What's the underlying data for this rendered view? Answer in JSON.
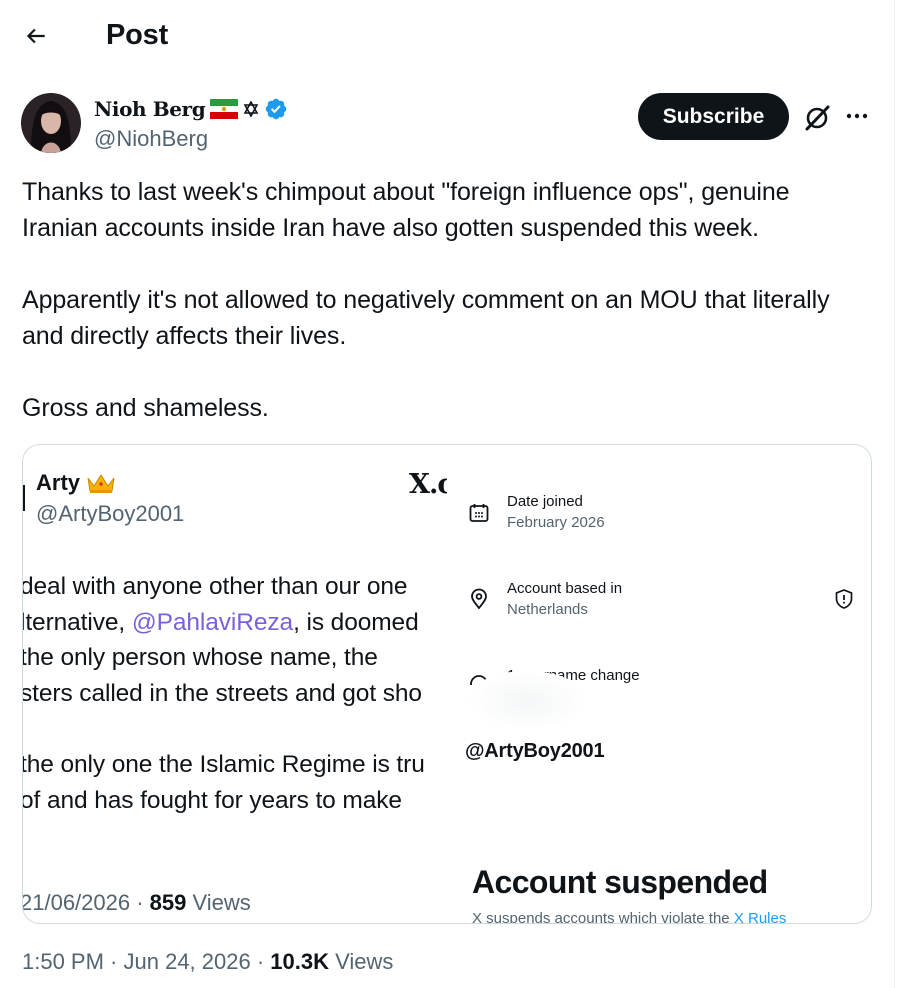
{
  "header": {
    "title": "Post"
  },
  "author": {
    "display_name": "Nioh Berg",
    "handle": "@NiohBerg",
    "verified": true
  },
  "actions": {
    "subscribe_label": "Subscribe"
  },
  "tweet": {
    "paragraphs": [
      "Thanks to last week's chimpout about \"foreign influence ops\", genuine Iranian accounts inside Iran have also gotten suspended this week.",
      "Apparently it's not allowed to negatively comment on an MOU that literally and directly affects their lives.",
      "Gross and shameless."
    ],
    "time": "1:50 PM",
    "date": "Jun 24, 2026",
    "views_count": "10.3K",
    "views_label": "Views"
  },
  "media": {
    "left": {
      "name": "Arty",
      "handle": "@ArtyBoy2001",
      "x_logo_text": "X.c",
      "lines": [
        " deal with anyone other than our one",
        " lternative, ",
        "the only person whose name, the",
        "sters called in the streets and got sho",
        "the only one the Islamic Regime is tru",
        " of and has fought for years to make"
      ],
      "mention": "@PahlaviReza",
      "mention_suffix": ", is doomed",
      "date": "21/06/2026",
      "views_count": "859",
      "views_label": "Views"
    },
    "right": {
      "date_joined_label": "Date joined",
      "date_joined_value": "February 2026",
      "based_label": "Account based in",
      "based_value": "Netherlands",
      "username_change": "1 username change",
      "handle": "@ArtyBoy2001",
      "suspended_title": "Account suspended",
      "suspended_sub": "X suspends accounts which violate the ",
      "suspended_link": "X Rules"
    }
  },
  "colors": {
    "verified": "#1d9bf0",
    "mention": "#7b61d9",
    "muted": "#536471",
    "text": "#0f1419"
  }
}
